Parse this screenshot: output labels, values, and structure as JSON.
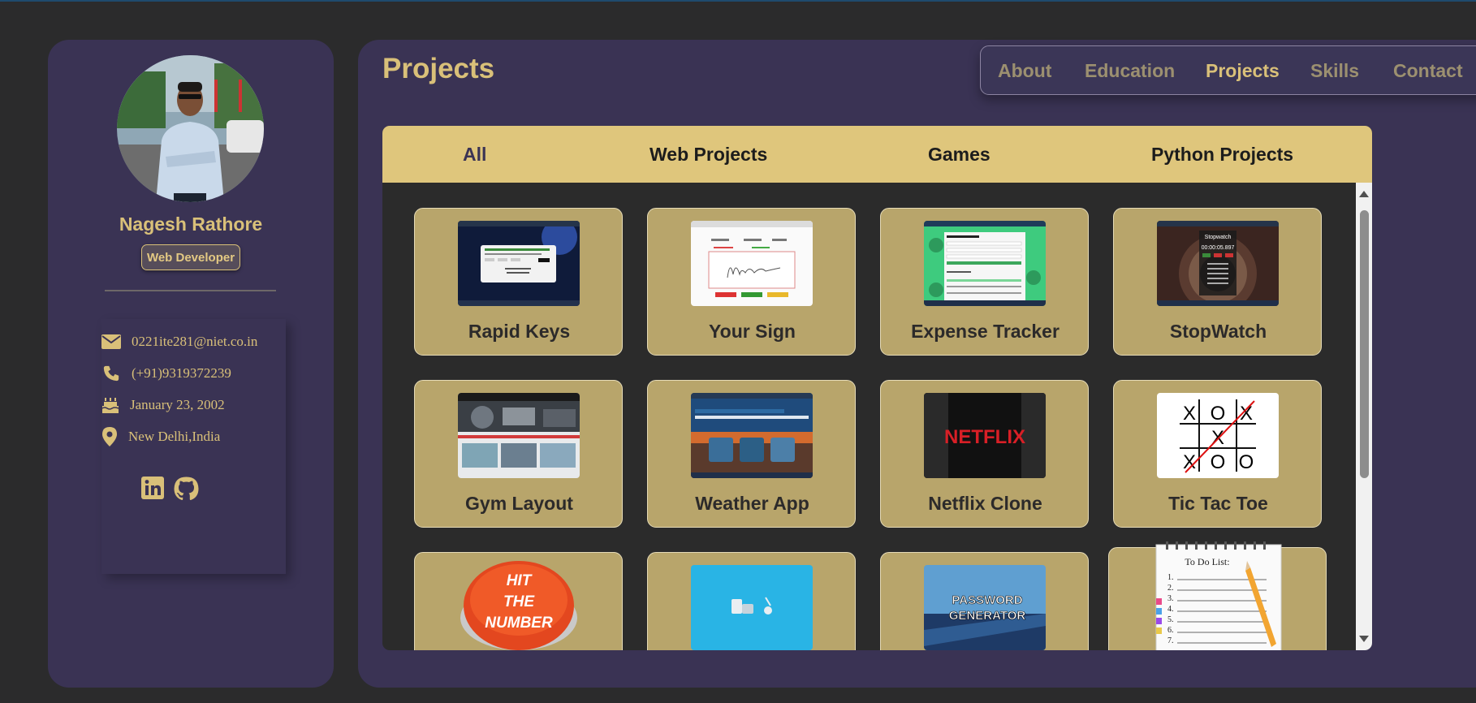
{
  "profile": {
    "name": "Nagesh Rathore",
    "role": "Web Developer",
    "contacts": [
      {
        "icon": "mail-icon",
        "text": "0221ite281@niet.co.in"
      },
      {
        "icon": "phone-icon",
        "text": "(+91)9319372239"
      },
      {
        "icon": "birthday-cake-icon",
        "text": "January 23, 2002"
      },
      {
        "icon": "location-pin-icon",
        "text": "New Delhi,India"
      }
    ],
    "social": [
      "linkedin-icon",
      "github-icon"
    ]
  },
  "page": {
    "title": "Projects"
  },
  "nav": {
    "items": [
      "About",
      "Education",
      "Projects",
      "Skills",
      "Contact"
    ],
    "active": "Projects"
  },
  "filters": {
    "items": [
      "All",
      "Web Projects",
      "Games",
      "Python Projects"
    ],
    "active": "All"
  },
  "projects": [
    {
      "title": "Rapid Keys"
    },
    {
      "title": "Your Sign"
    },
    {
      "title": "Expense Tracker"
    },
    {
      "title": "StopWatch"
    },
    {
      "title": "Gym Layout"
    },
    {
      "title": "Weather App"
    },
    {
      "title": "Netflix Clone"
    },
    {
      "title": "Tic Tac Toe"
    },
    {
      "title": "Hit The Number",
      "thumb_text": [
        "HIT",
        "THE",
        "NUMBER"
      ]
    },
    {
      "title": ""
    },
    {
      "title": "",
      "thumb_text": [
        "PASSWORD",
        "GENERATOR"
      ]
    },
    {
      "title": "",
      "thumb_text": [
        "To Do List:"
      ]
    }
  ],
  "thumb_texts": {
    "netflix": "NETFLIX",
    "stopwatch_time": "00:00:05.897",
    "stopwatch_title": "Stopwatch",
    "tictactoe_rows": [
      "XOX",
      " X ",
      "XOO"
    ],
    "todo_numbers": [
      "1.",
      "2.",
      "3.",
      "4.",
      "5.",
      "6.",
      "7."
    ]
  },
  "colors": {
    "background": "#2b2b2c",
    "panel": "#3a3354",
    "accent": "#d9c079",
    "card": "#b8a56b",
    "tab_bar": "#dfc67c"
  }
}
